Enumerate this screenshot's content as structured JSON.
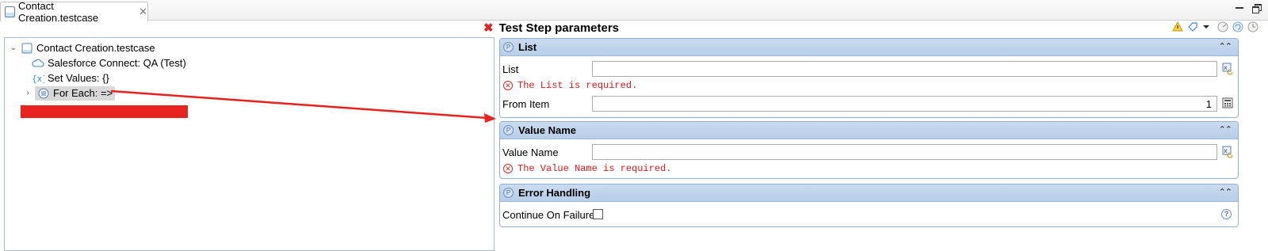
{
  "tab": {
    "label": "Contact Creation.testcase",
    "close": "✕"
  },
  "tree": {
    "root": {
      "label": "Contact Creation.testcase",
      "twisty": "⌄"
    },
    "items": [
      {
        "label": "Salesforce Connect: QA (Test)",
        "icon": "cloud-icon"
      },
      {
        "label": "Set Values: {}",
        "icon": "braces-icon"
      },
      {
        "label": "For Each: =>",
        "icon": "loop-icon",
        "twisty": "›",
        "selected": true
      }
    ]
  },
  "header": {
    "title": "Test Step parameters",
    "error_mark": "✖"
  },
  "sections": {
    "list": {
      "title": "List",
      "collapse": "⌃⌃",
      "list_label": "List",
      "list_value": "",
      "list_error": "The List is required.",
      "from_item_label": "From Item",
      "from_item_value": "1"
    },
    "value_name": {
      "title": "Value Name",
      "collapse": "⌃⌃",
      "value_name_label": "Value Name",
      "value_name_value": "",
      "value_name_error": "The Value Name is required."
    },
    "error_handling": {
      "title": "Error Handling",
      "collapse": "⌃⌃",
      "continue_label": "Continue On Failure",
      "continue_checked": false,
      "help": "?"
    }
  },
  "colors": {
    "accent": "#b8cee8",
    "error": "#e01919",
    "arrow": "#e8231f",
    "redaction": "#e8231f"
  }
}
